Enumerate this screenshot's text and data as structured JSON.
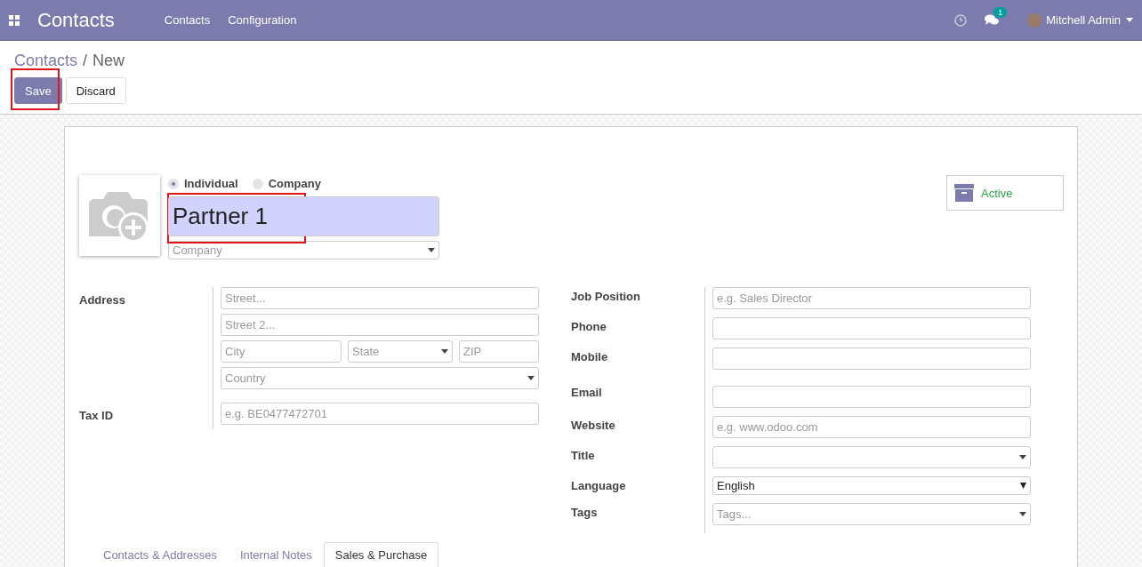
{
  "navbar": {
    "app_title": "Contacts",
    "menu": [
      "Contacts",
      "Configuration"
    ],
    "chat_count": "1",
    "user": "Mitchell Admin"
  },
  "breadcrumb": {
    "items": [
      "Contacts",
      "New"
    ],
    "separator": "/"
  },
  "buttons": [
    {
      "label": "Save",
      "kind": "primary",
      "highlighted": true
    },
    {
      "label": "Discard",
      "kind": "secondary",
      "highlighted": false
    }
  ],
  "company_type": [
    {
      "label": "Individual",
      "selected": true
    },
    {
      "label": "Company",
      "selected": false
    }
  ],
  "name": {
    "value": "Partner 1",
    "highlighted": true
  },
  "parent": {
    "placeholder": "Company",
    "kind": "select"
  },
  "active_button": {
    "label": "Active"
  },
  "left_group": [
    {
      "label": "Address",
      "lines": [
        [
          {
            "kind": "text",
            "placeholder": "Street..."
          }
        ],
        [
          {
            "kind": "text",
            "placeholder": "Street 2..."
          }
        ],
        [
          {
            "kind": "text",
            "placeholder": "City"
          },
          {
            "kind": "select",
            "placeholder": "State"
          },
          {
            "kind": "text",
            "placeholder": "ZIP"
          }
        ],
        [
          {
            "kind": "select",
            "placeholder": "Country"
          }
        ]
      ]
    },
    {
      "label": "Tax ID",
      "lines": [
        [
          {
            "kind": "text",
            "placeholder": "e.g. BE0477472701"
          }
        ]
      ]
    }
  ],
  "right_group": [
    {
      "label": "Job Position",
      "field": {
        "kind": "text",
        "placeholder": "e.g. Sales Director"
      }
    },
    {
      "label": "Phone",
      "field": {
        "kind": "text"
      }
    },
    {
      "label": "Mobile",
      "field": {
        "kind": "text"
      }
    },
    {
      "label": "Email",
      "field": {
        "kind": "text"
      }
    },
    {
      "label": "Website",
      "field": {
        "kind": "text",
        "placeholder": "e.g. www.odoo.com"
      }
    },
    {
      "label": "Title",
      "field": {
        "kind": "select"
      }
    },
    {
      "label": "Language",
      "field": {
        "kind": "native",
        "value": "English"
      }
    },
    {
      "label": "Tags",
      "field": {
        "kind": "select",
        "placeholder": "Tags..."
      }
    }
  ],
  "notebook_tabs": [
    {
      "label": "Contacts & Addresses",
      "selected": false
    },
    {
      "label": "Internal Notes",
      "selected": false
    },
    {
      "label": "Sales & Purchase",
      "selected": true
    }
  ]
}
